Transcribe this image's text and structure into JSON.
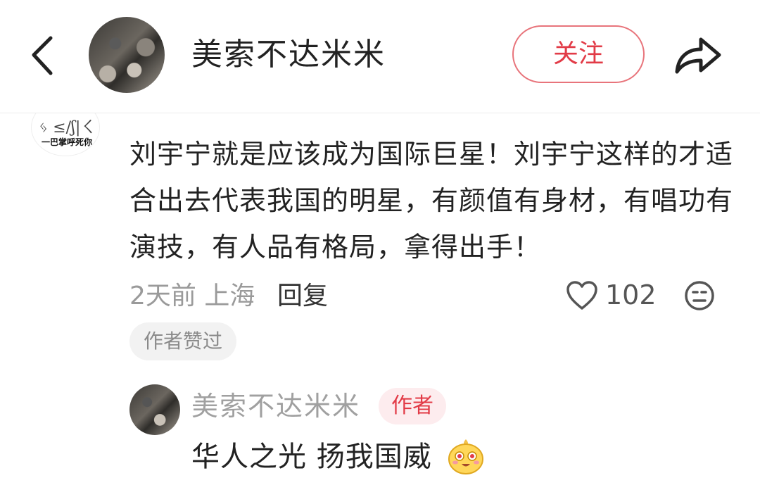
{
  "header": {
    "username": "美索不达米米",
    "follow_label": "关注"
  },
  "comment": {
    "avatar_caption": "一巴掌呼死你",
    "text": "刘宇宁就是应该成为国际巨星！刘宇宁这样的才适合出去代表我国的明星，有颜值有身材，有唱功有演技，有人品有格局，拿得出手！",
    "meta": "2天前 上海",
    "reply_label": "回复",
    "like_count": "102",
    "author_liked_tag": "作者赞过"
  },
  "reply": {
    "username": "美索不达米米",
    "author_badge": "作者",
    "text": "华人之光 扬我国威"
  },
  "colors": {
    "accent_red": "#e23b47",
    "follow_border": "#e8747b",
    "text_primary": "#222222",
    "text_secondary": "#9a9a9a",
    "tag_bg": "#f2f2f2",
    "badge_bg": "#fdecee"
  },
  "icons": [
    "back-chevron-icon",
    "share-arrow-icon",
    "heart-icon",
    "dislike-face-icon",
    "smiling-face-emoji-icon"
  ]
}
